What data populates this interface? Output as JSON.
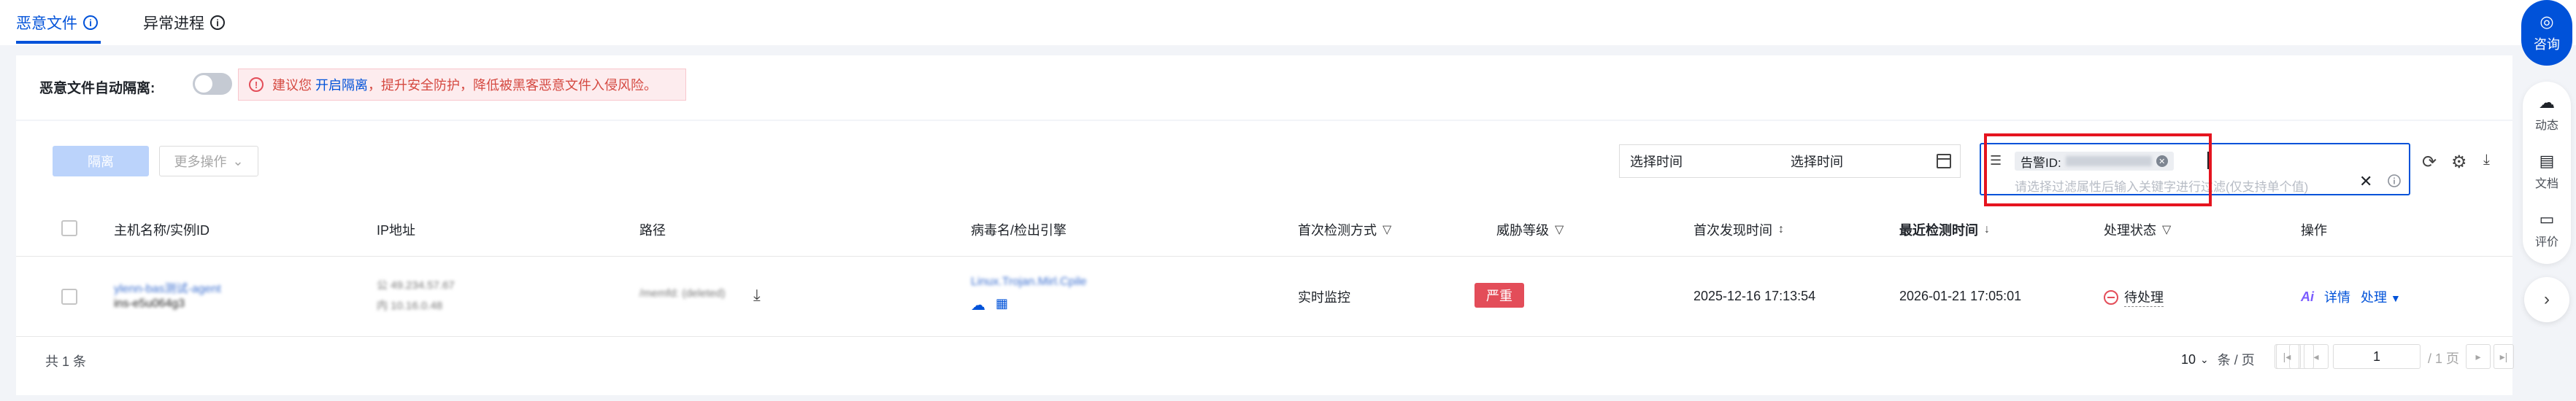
{
  "tabs": [
    {
      "label": "恶意文件",
      "active": true
    },
    {
      "label": "异常进程",
      "active": false
    }
  ],
  "isolation": {
    "label": "恶意文件自动隔离:",
    "enabled": false,
    "warning_prefix": "建议您",
    "warning_link": "开启隔离",
    "warning_suffix": "，提升安全防护，降低被黑客恶意文件入侵风险。"
  },
  "toolbar": {
    "isolate_label": "隔离",
    "more_label": "更多操作",
    "date_start_placeholder": "选择时间",
    "date_end_placeholder": "选择时间",
    "search_chip_key": "告警ID:",
    "search_placeholder": "请选择过滤属性后输入关键字进行过滤(仅支持单个值)"
  },
  "table": {
    "columns": [
      "主机名称/实例ID",
      "IP地址",
      "路径",
      "病毒名/检出引擎",
      "首次检测方式",
      "威胁等级",
      "首次发现时间",
      "最近检测时间",
      "处理状态",
      "操作"
    ],
    "rows": [
      {
        "host_name": "ylenn-bas测试-agent",
        "instance_id": "ins-e5u064g3",
        "ip_public": "公 49.234.57.67",
        "ip_private": "内 10.16.0.48",
        "path": "/memfd: (deleted)",
        "virus_name": "Linux.Trojan.Mirl.Cpile",
        "detect_method": "实时监控",
        "threat_level": "严重",
        "first_found": "2025-12-16 17:13:54",
        "last_detected": "2026-01-21 17:05:01",
        "status": "待处理",
        "actions": {
          "ai": "Ai",
          "detail": "详情",
          "handle": "处理"
        }
      }
    ]
  },
  "pagination": {
    "total_label": "共 1 条",
    "page_size": "10",
    "page_size_unit": "条 / 页",
    "current_page": "1",
    "total_pages_label": "/ 1 页"
  },
  "side": {
    "consult": "咨询",
    "items": [
      "动态",
      "文档",
      "评价"
    ]
  },
  "colors": {
    "primary": "#0052d9",
    "danger": "#e34d59",
    "highlight_frame": "#e5141f"
  }
}
